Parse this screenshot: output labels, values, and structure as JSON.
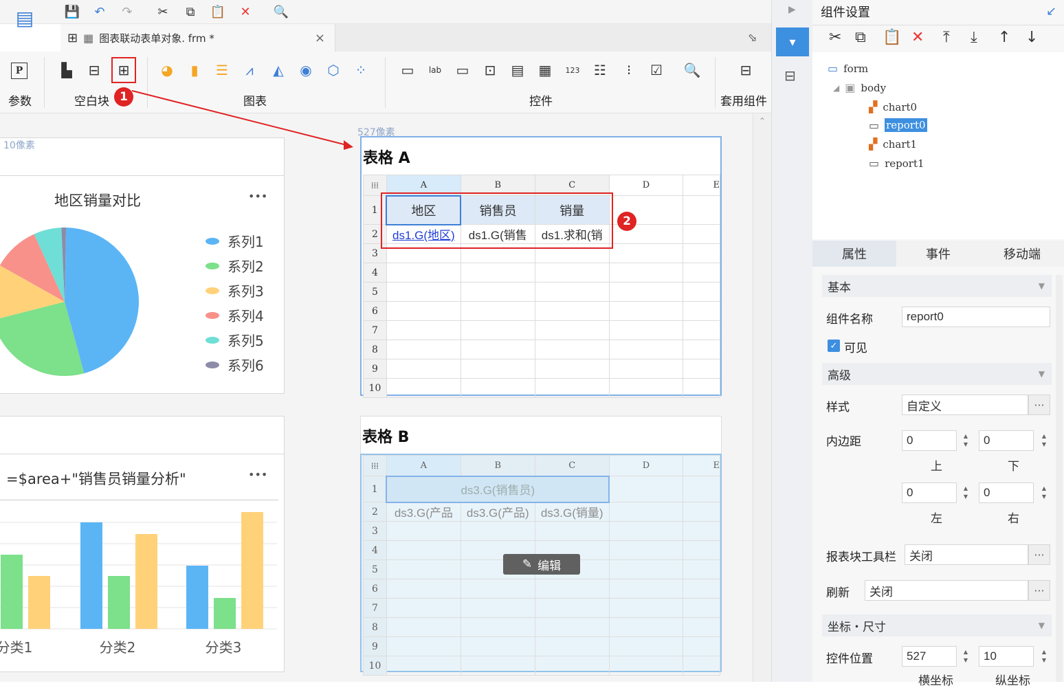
{
  "toolbar": {
    "icons": [
      "save-icon",
      "undo-icon",
      "redo-icon",
      "cut-icon",
      "copy-icon",
      "paste-icon",
      "delete-icon",
      "text-template-icon"
    ]
  },
  "tab": {
    "title": "图表联动表单对象. frm *",
    "close": "×"
  },
  "ribbon": {
    "groups": {
      "param": "参数",
      "blank": "空白块",
      "chart": "图表",
      "widget": "控件",
      "preset": "套用组件"
    }
  },
  "canvas": {
    "px_label_left": "10像素",
    "px_label_top": "527像素",
    "pie": {
      "title": "地区销量对比",
      "more": "•••",
      "legend": [
        "系列1",
        "系列2",
        "系列3",
        "系列4",
        "系列5",
        "系列6"
      ]
    },
    "bar": {
      "title": "=$area+\"销售员销量分析\"",
      "more": "•••",
      "categories": [
        "分类1",
        "分类2",
        "分类3"
      ]
    },
    "tableA": {
      "title": "表格 A",
      "columns": [
        "A",
        "B",
        "C",
        "D",
        "E"
      ],
      "rows": [
        "1",
        "2",
        "3",
        "4",
        "5",
        "6",
        "7",
        "8",
        "9",
        "10"
      ],
      "header": [
        "地区",
        "销售员",
        "销量"
      ],
      "data": [
        "ds1.G(地区)",
        "ds1.G(销售",
        "ds1.求和(销"
      ]
    },
    "tableB": {
      "title": "表格 B",
      "columns": [
        "A",
        "B",
        "C",
        "D",
        "E"
      ],
      "rows": [
        "1",
        "2",
        "3",
        "4",
        "5",
        "6",
        "7",
        "8",
        "9",
        "10"
      ],
      "header": "ds3.G(销售员)",
      "data": [
        "ds3.G(产品",
        "ds3.G(产品)",
        "ds3.G(销量)"
      ],
      "edit": "编辑"
    },
    "badges": [
      "1",
      "2"
    ]
  },
  "chart_data": [
    {
      "type": "pie",
      "title": "地区销量对比",
      "categories": [
        "系列1",
        "系列2",
        "系列3",
        "系列4",
        "系列5",
        "系列6"
      ],
      "values": [
        45,
        25,
        12,
        10,
        6,
        1
      ],
      "colors": [
        "#5bb5f5",
        "#7de08a",
        "#ffd27a",
        "#f8918a",
        "#6fded6",
        "#8c8ca8"
      ]
    },
    {
      "type": "bar",
      "title": "=$area+\"销售员销量分析\"",
      "categories": [
        "分类1",
        "分类2",
        "分类3"
      ],
      "series": [
        {
          "values": [
            0,
            155,
            92
          ],
          "color": "#5bb5f5"
        },
        {
          "values": [
            108,
            77,
            45
          ],
          "color": "#7de08a"
        },
        {
          "values": [
            77,
            138,
            170
          ],
          "color": "#ffd27a"
        }
      ]
    }
  ],
  "right": {
    "title": "组件设置",
    "tree": [
      "form",
      "body",
      "chart0",
      "report0",
      "chart1",
      "report1"
    ],
    "tabs": [
      "属性",
      "事件",
      "移动端"
    ],
    "basic": "基本",
    "name_label": "组件名称",
    "name_value": "report0",
    "visible": "可见",
    "advanced": "高级",
    "style_label": "样式",
    "style_value": "自定义",
    "padding_label": "内边距",
    "pad_top": "0",
    "pad_bottom": "0",
    "pad_left": "0",
    "pad_right": "0",
    "top": "上",
    "bottom": "下",
    "left": "左",
    "right": "右",
    "toolbar_label": "报表块工具栏",
    "toolbar_value": "关闭",
    "refresh_label": "刷新",
    "refresh_value": "关闭",
    "coord": "坐标・尺寸",
    "pos_label": "控件位置",
    "pos_x": "527",
    "pos_y": "10",
    "x_label": "横坐标",
    "y_label": "纵坐标",
    "dots": "···"
  }
}
